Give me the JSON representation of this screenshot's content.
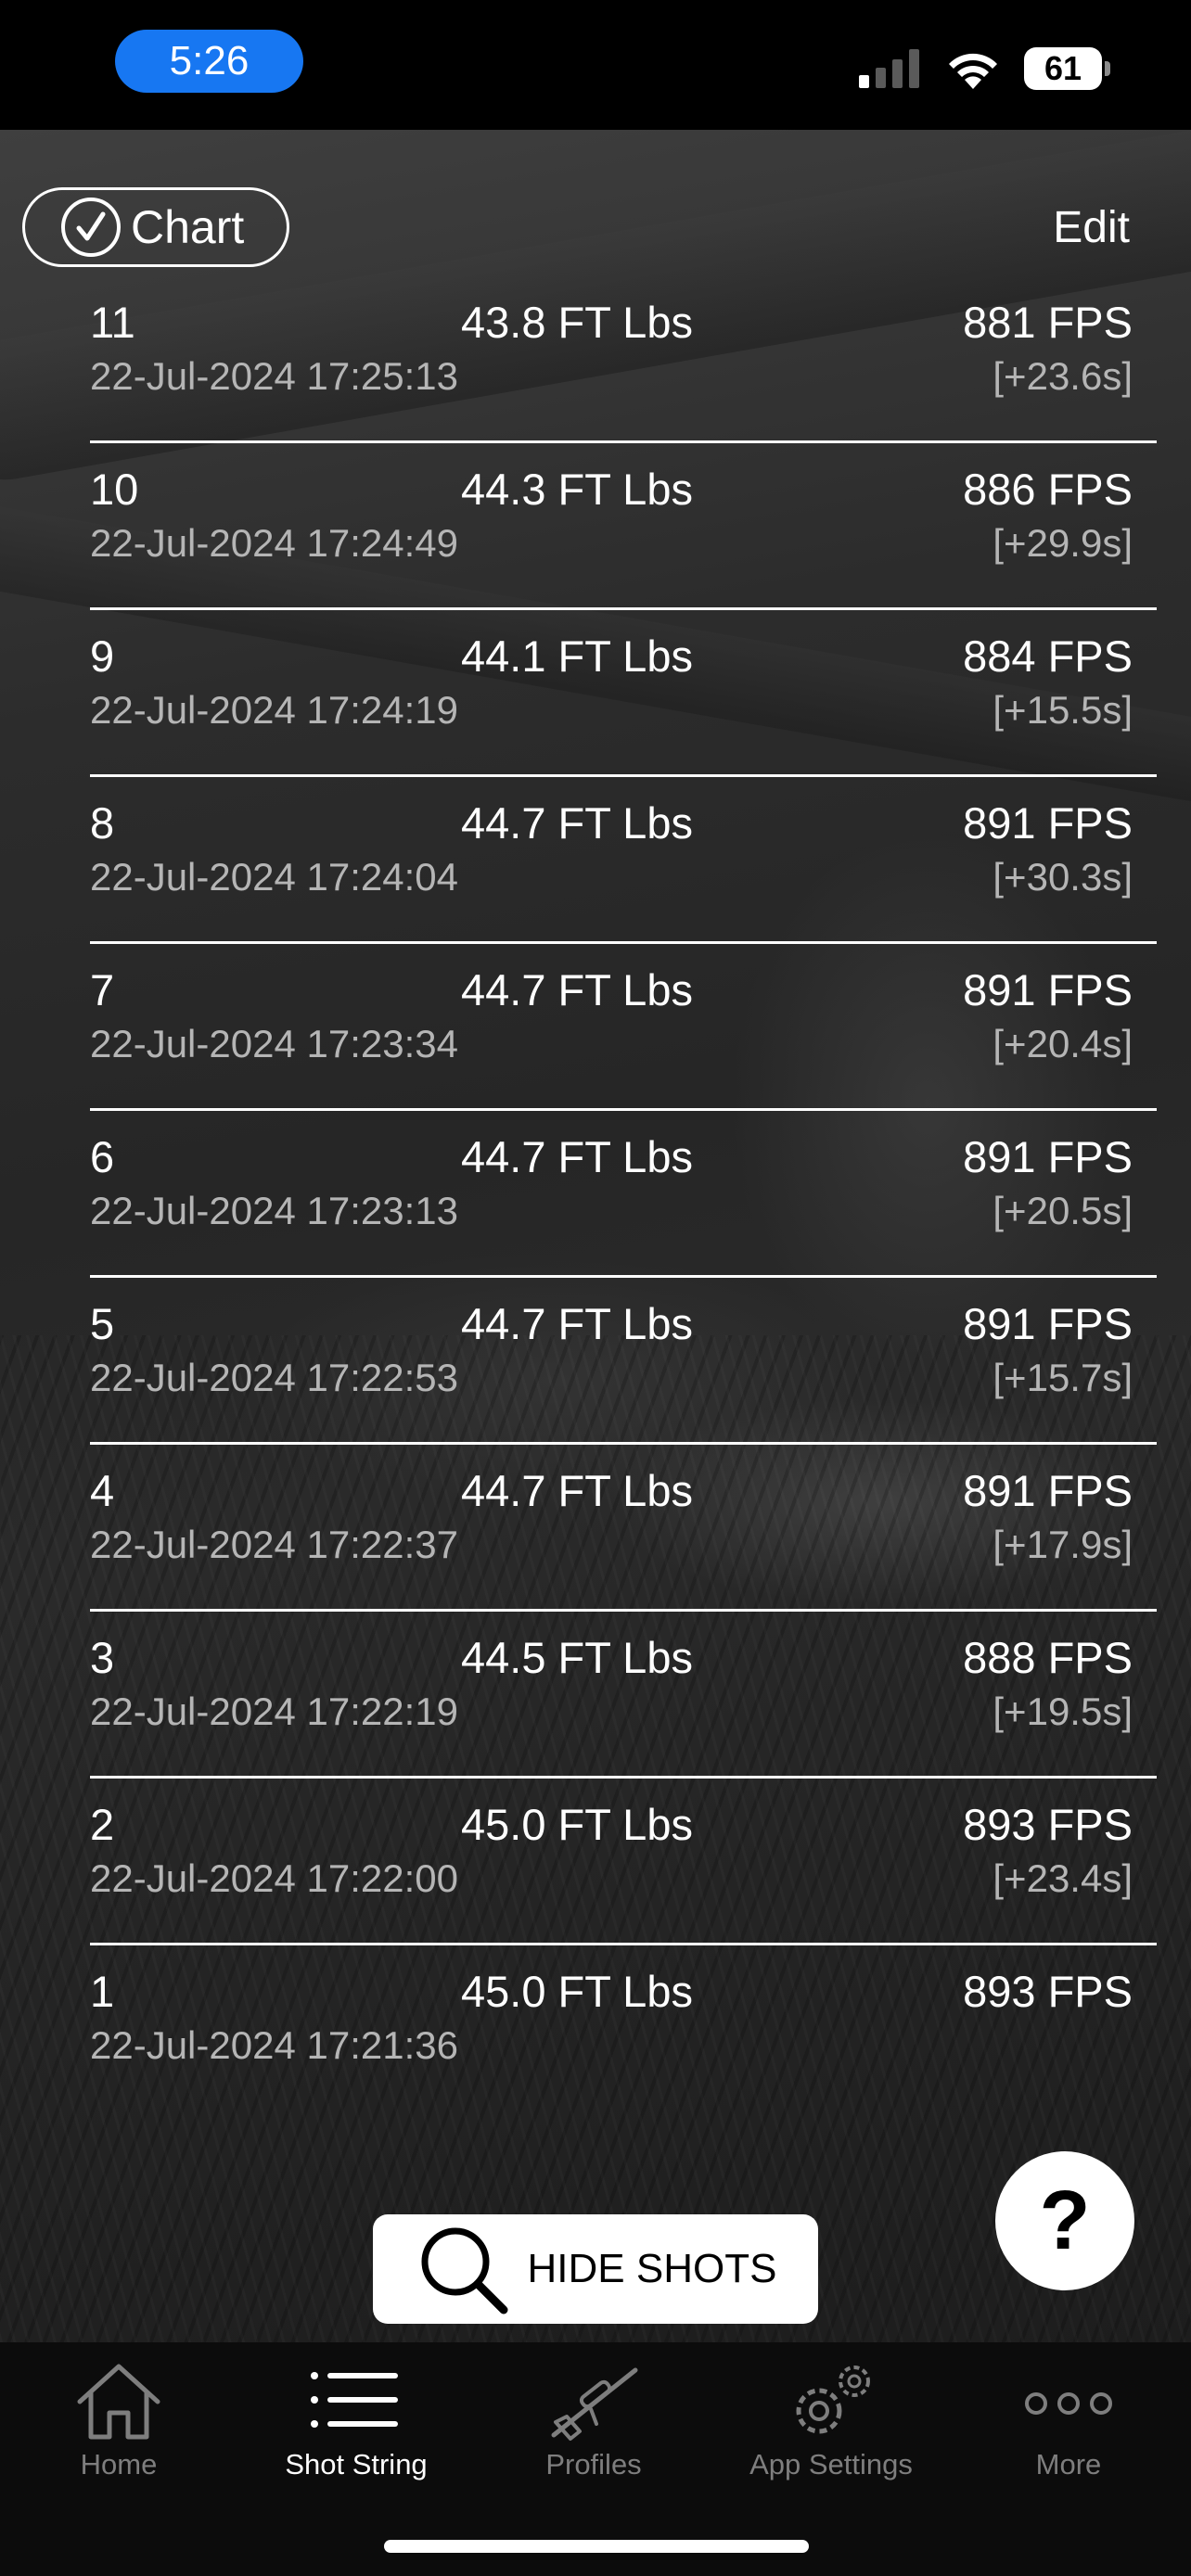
{
  "status_bar": {
    "time": "5:26",
    "battery": "61"
  },
  "header": {
    "chart_label": "Chart",
    "edit_label": "Edit"
  },
  "shots": [
    {
      "num": "11",
      "energy": "43.8 FT Lbs",
      "fps": "881 FPS",
      "timestamp": "22-Jul-2024 17:25:13",
      "delta": "[+23.6s]"
    },
    {
      "num": "10",
      "energy": "44.3 FT Lbs",
      "fps": "886 FPS",
      "timestamp": "22-Jul-2024 17:24:49",
      "delta": "[+29.9s]"
    },
    {
      "num": "9",
      "energy": "44.1 FT Lbs",
      "fps": "884 FPS",
      "timestamp": "22-Jul-2024 17:24:19",
      "delta": "[+15.5s]"
    },
    {
      "num": "8",
      "energy": "44.7 FT Lbs",
      "fps": "891 FPS",
      "timestamp": "22-Jul-2024 17:24:04",
      "delta": "[+30.3s]"
    },
    {
      "num": "7",
      "energy": "44.7 FT Lbs",
      "fps": "891 FPS",
      "timestamp": "22-Jul-2024 17:23:34",
      "delta": "[+20.4s]"
    },
    {
      "num": "6",
      "energy": "44.7 FT Lbs",
      "fps": "891 FPS",
      "timestamp": "22-Jul-2024 17:23:13",
      "delta": "[+20.5s]"
    },
    {
      "num": "5",
      "energy": "44.7 FT Lbs",
      "fps": "891 FPS",
      "timestamp": "22-Jul-2024 17:22:53",
      "delta": "[+15.7s]"
    },
    {
      "num": "4",
      "energy": "44.7 FT Lbs",
      "fps": "891 FPS",
      "timestamp": "22-Jul-2024 17:22:37",
      "delta": "[+17.9s]"
    },
    {
      "num": "3",
      "energy": "44.5 FT Lbs",
      "fps": "888 FPS",
      "timestamp": "22-Jul-2024 17:22:19",
      "delta": "[+19.5s]"
    },
    {
      "num": "2",
      "energy": "45.0 FT Lbs",
      "fps": "893 FPS",
      "timestamp": "22-Jul-2024 17:22:00",
      "delta": "[+23.4s]"
    },
    {
      "num": "1",
      "energy": "45.0 FT Lbs",
      "fps": "893 FPS",
      "timestamp": "22-Jul-2024 17:21:36",
      "delta": ""
    }
  ],
  "help_label": "?",
  "hide_shots_label": "HIDE SHOTS",
  "tabs": [
    {
      "label": "Home",
      "icon": "home-icon"
    },
    {
      "label": "Shot String",
      "icon": "list-icon",
      "active": true
    },
    {
      "label": "Profiles",
      "icon": "rifle-icon"
    },
    {
      "label": "App Settings",
      "icon": "gear-icon"
    },
    {
      "label": "More",
      "icon": "more-icon"
    }
  ],
  "colors": {
    "time_pill": "#1777f2",
    "tab_active": "#ffffff",
    "tab_inactive": "#7e7e7e"
  }
}
